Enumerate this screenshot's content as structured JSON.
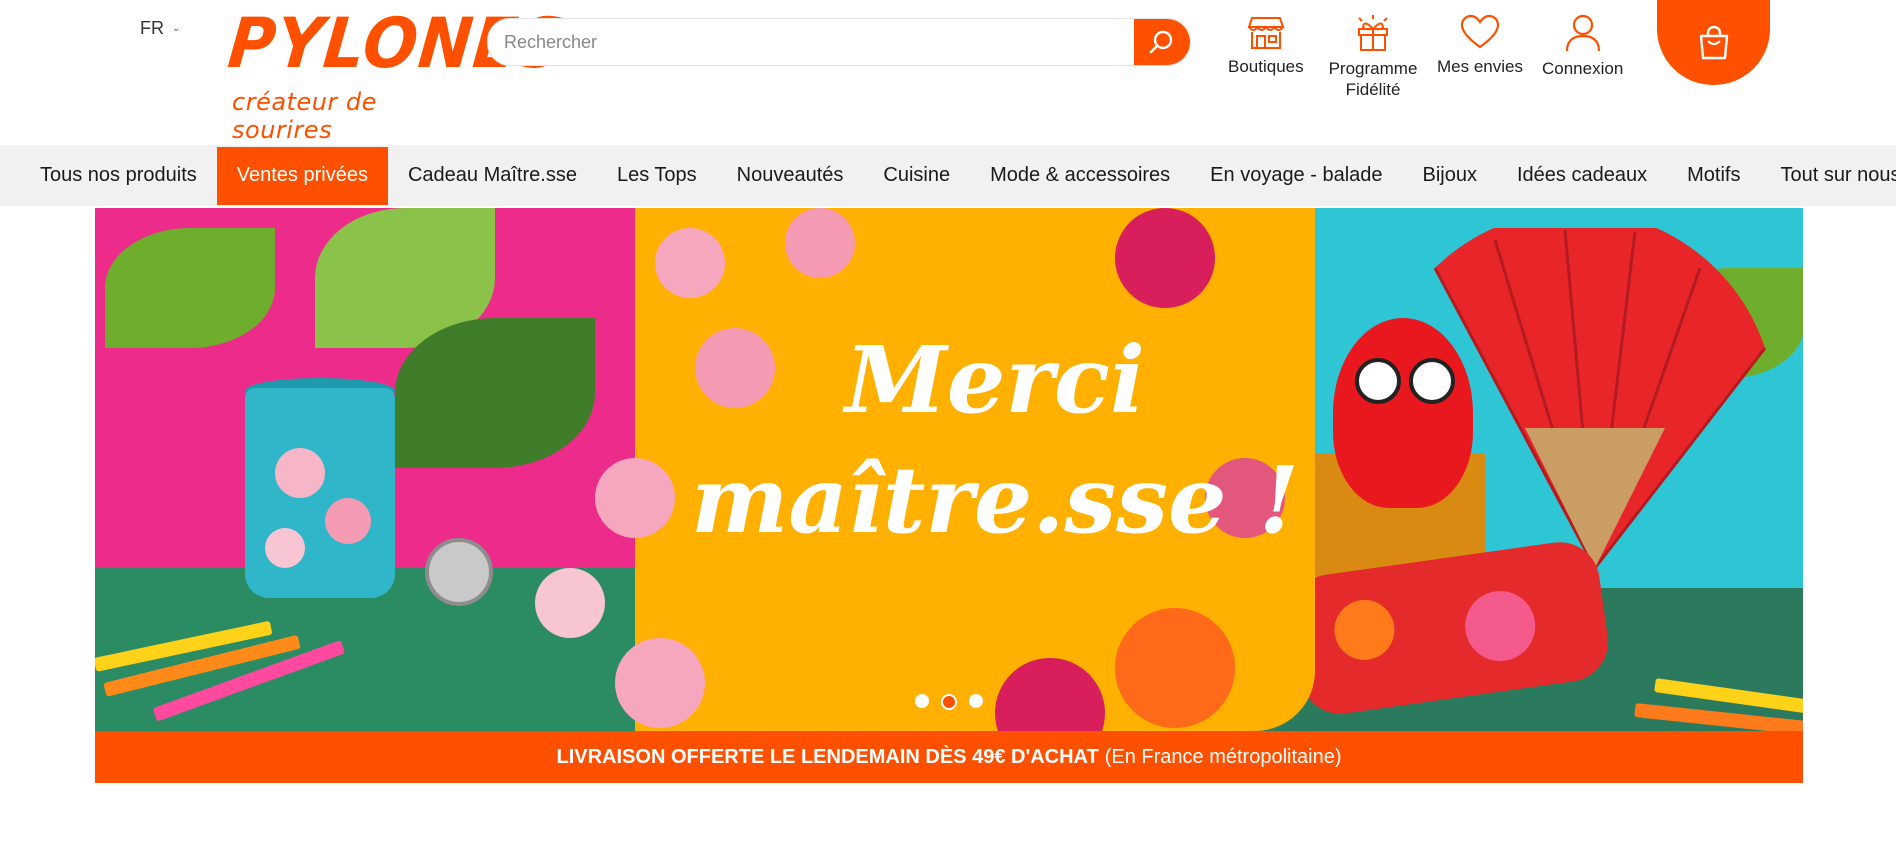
{
  "header": {
    "language": "FR",
    "logo": {
      "word": "PYLONES",
      "tagline": "créateur de sourires"
    },
    "search": {
      "placeholder": "Rechercher"
    },
    "icons": [
      {
        "name": "store-icon",
        "label": "Boutiques"
      },
      {
        "name": "gift-icon",
        "label": "Programme Fidélité"
      },
      {
        "name": "heart-icon",
        "label": "Mes envies"
      },
      {
        "name": "user-icon",
        "label": "Connexion"
      }
    ],
    "cart_icon": "shopping-bag-icon"
  },
  "nav": {
    "items": [
      "Tous nos produits",
      "Ventes privées",
      "Cadeau Maître.sse",
      "Les Tops",
      "Nouveautés",
      "Cuisine",
      "Mode & accessoires",
      "En voyage - balade",
      "Bijoux",
      "Idées cadeaux",
      "Motifs",
      "Tout sur nous"
    ],
    "active_index": 1
  },
  "banner": {
    "headline_line1": "Merci",
    "headline_line2": "maître.sse !",
    "slides": 3,
    "active_slide": 2
  },
  "promo": {
    "bold": "LIVRAISON OFFERTE LE LENDEMAIN DÈS 49€ D'ACHAT",
    "normal": "(En France métropolitaine)"
  },
  "colors": {
    "accent": "#ff5000",
    "nav_bg": "#f1f1f1",
    "banner_yellow": "#ffb000"
  }
}
